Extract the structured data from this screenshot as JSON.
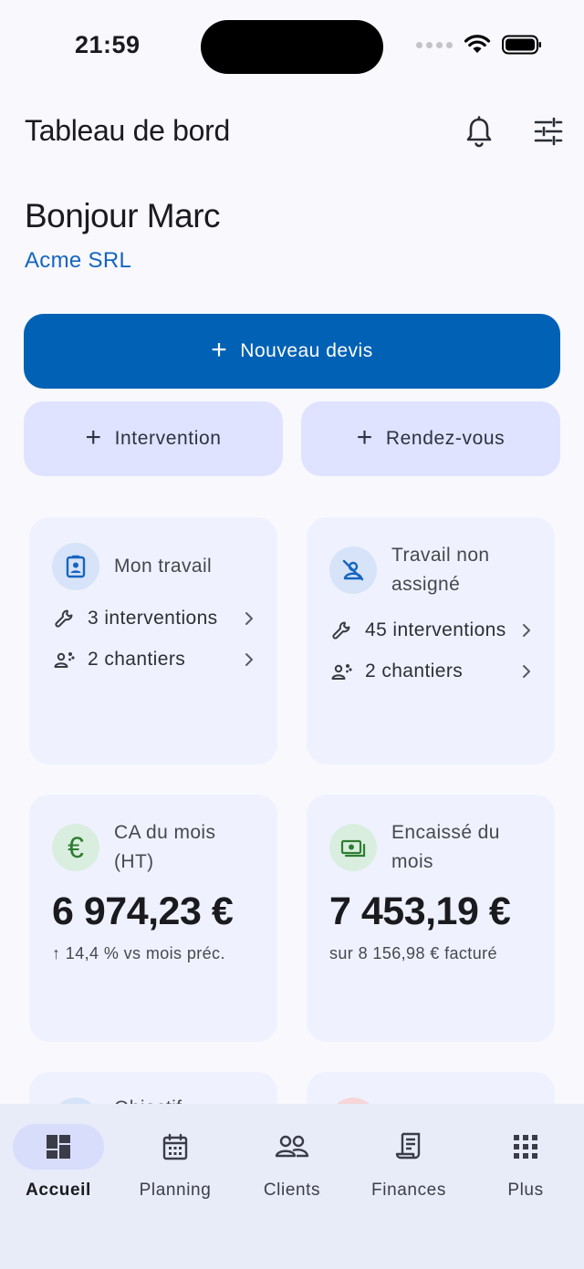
{
  "status_bar": {
    "time": "21:59"
  },
  "app_bar": {
    "title": "Tableau de bord"
  },
  "greeting": {
    "hello": "Bonjour Marc",
    "company": "Acme SRL"
  },
  "actions": {
    "primary": "Nouveau devis",
    "secondary": [
      "Intervention",
      "Rendez-vous"
    ]
  },
  "cards": {
    "my_work": {
      "title": "Mon travail",
      "rows": [
        "3 interventions",
        "2 chantiers"
      ]
    },
    "unassigned": {
      "title": "Travail non assigné",
      "rows": [
        "45 interventions",
        "2 chantiers"
      ]
    },
    "revenue": {
      "title": "CA du mois (HT)",
      "amount": "6 974,23 €",
      "sub": "↑ 14,4 % vs mois préc."
    },
    "collected": {
      "title": "Encaissé du mois",
      "amount": "7 453,19 €",
      "sub": "sur 8 156,98 € facturé"
    },
    "partial_left": {
      "title": "Objectif"
    }
  },
  "nav": {
    "items": [
      "Accueil",
      "Planning",
      "Clients",
      "Finances",
      "Plus"
    ],
    "active": "Accueil"
  },
  "colors": {
    "primary": "#0061b5",
    "secondary_button": "#dfe3ff",
    "card": "#eff2fe",
    "accent_text": "#1565c0",
    "euro_green": "#2e7d32"
  }
}
